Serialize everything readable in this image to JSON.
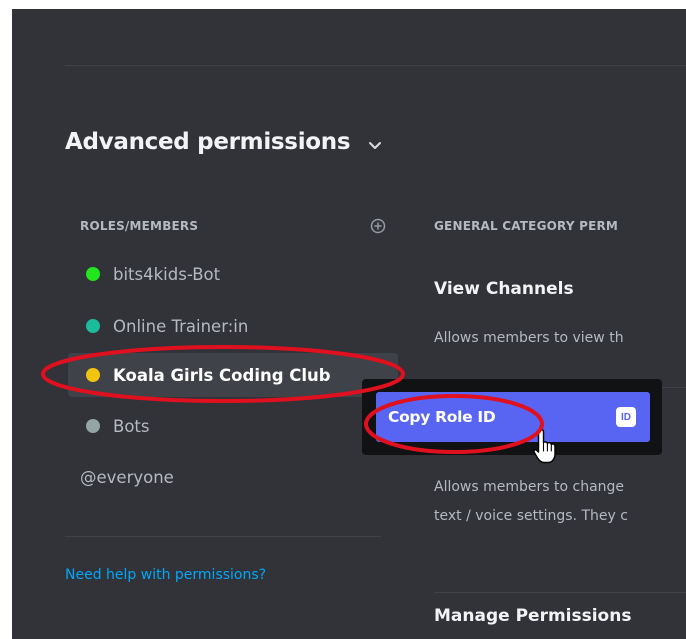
{
  "section": {
    "title": "Advanced permissions"
  },
  "roles_header": "ROLES/MEMBERS",
  "roles": [
    {
      "label": "bits4kids-Bot",
      "color": "#23e51d",
      "selected": false
    },
    {
      "label": "Online Trainer:in",
      "color": "#1abc9c",
      "selected": false
    },
    {
      "label": "Koala Girls Coding Club",
      "color": "#f1c40f",
      "selected": true
    },
    {
      "label": "Bots",
      "color": "#95a5a6",
      "selected": false
    },
    {
      "label": "@everyone",
      "color": null,
      "selected": false
    }
  ],
  "help_link": "Need help with permissions?",
  "permissions": {
    "category_header": "GENERAL CATEGORY PERM",
    "view_channels": {
      "title": "View Channels",
      "description": "Allows members to view th"
    },
    "manage_channels": {
      "description_line1": "Allows members to change",
      "description_line2": "text / voice settings. They c"
    },
    "manage_permissions": {
      "title": "Manage Permissions"
    }
  },
  "context_menu": {
    "item_label": "Copy Role ID",
    "badge": "ID"
  },
  "colors": {
    "background": "#313338",
    "accent": "#5865f2",
    "link": "#00a8fc",
    "annotation": "#e0101e"
  }
}
